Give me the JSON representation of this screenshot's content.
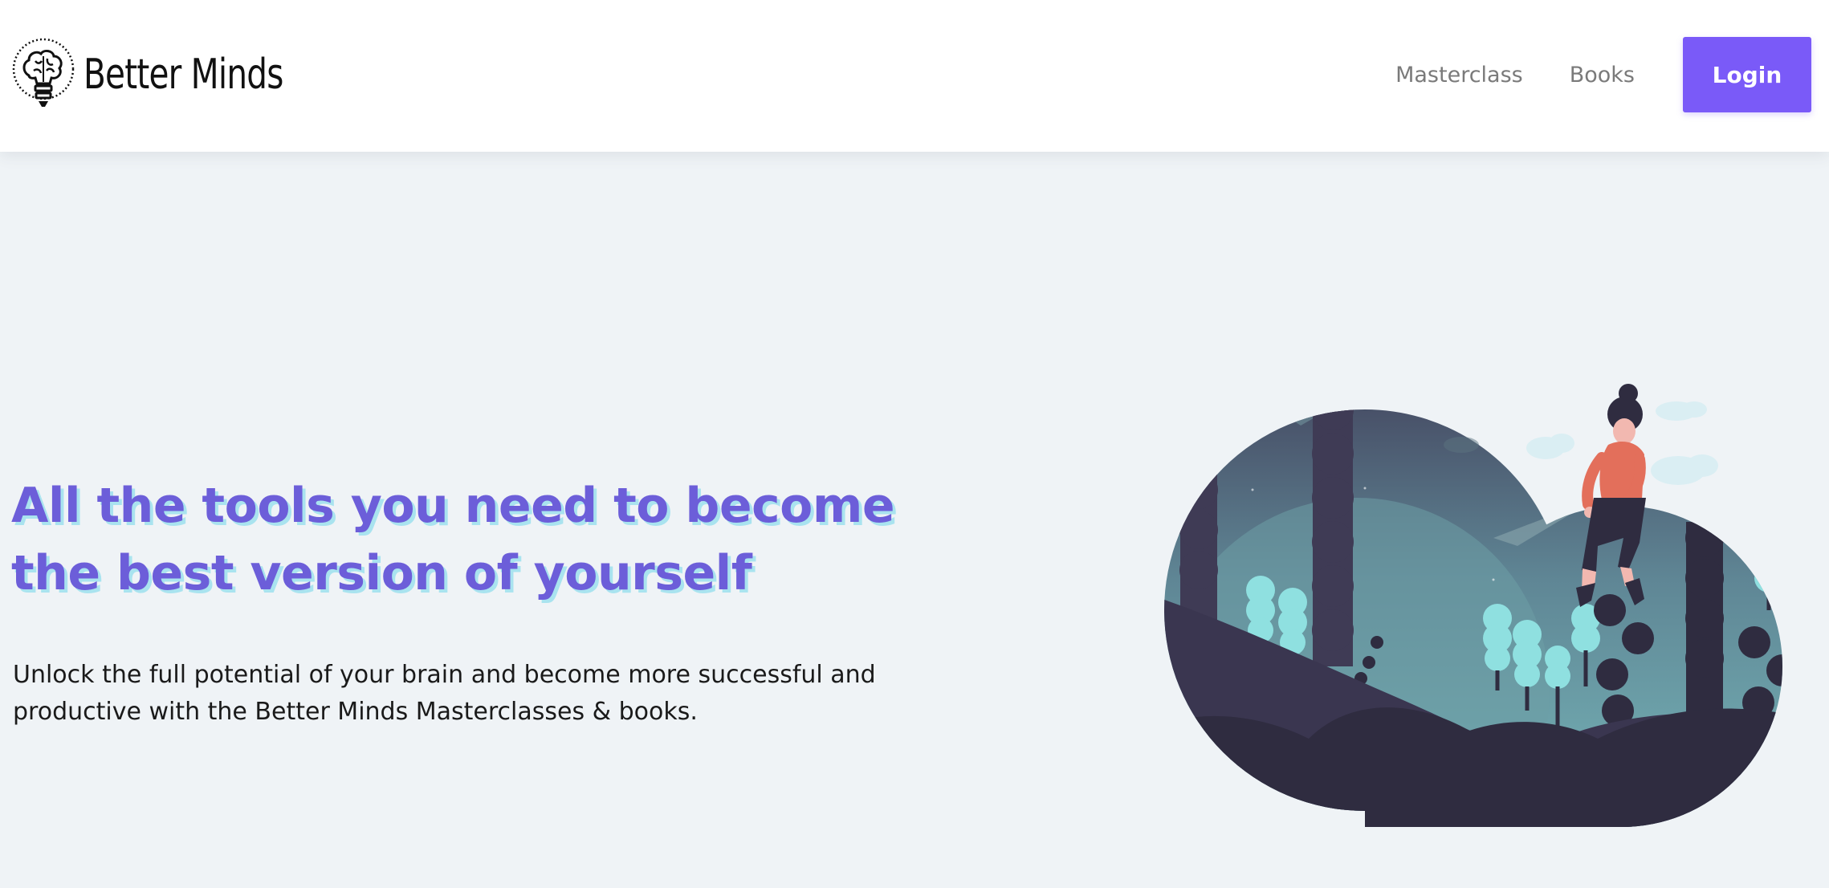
{
  "header": {
    "brand_name": "Better Minds",
    "logo_icon": "brain-lightbulb-icon",
    "nav": {
      "masterclass": "Masterclass",
      "books": "Books",
      "login": "Login"
    }
  },
  "hero": {
    "title": "All the tools you need to become the best version of yourself",
    "subtitle": "Unlock the full potential of your brain and become more successful and productive with the Better Minds Masterclasses & books.",
    "illustration": "woman-sitting-on-forest-cloud-illustration"
  },
  "colors": {
    "accent": "#7a5af8",
    "title": "#6c5ed9",
    "title_shadow": "#a9e3ef",
    "page_background": "#eff3f6"
  }
}
